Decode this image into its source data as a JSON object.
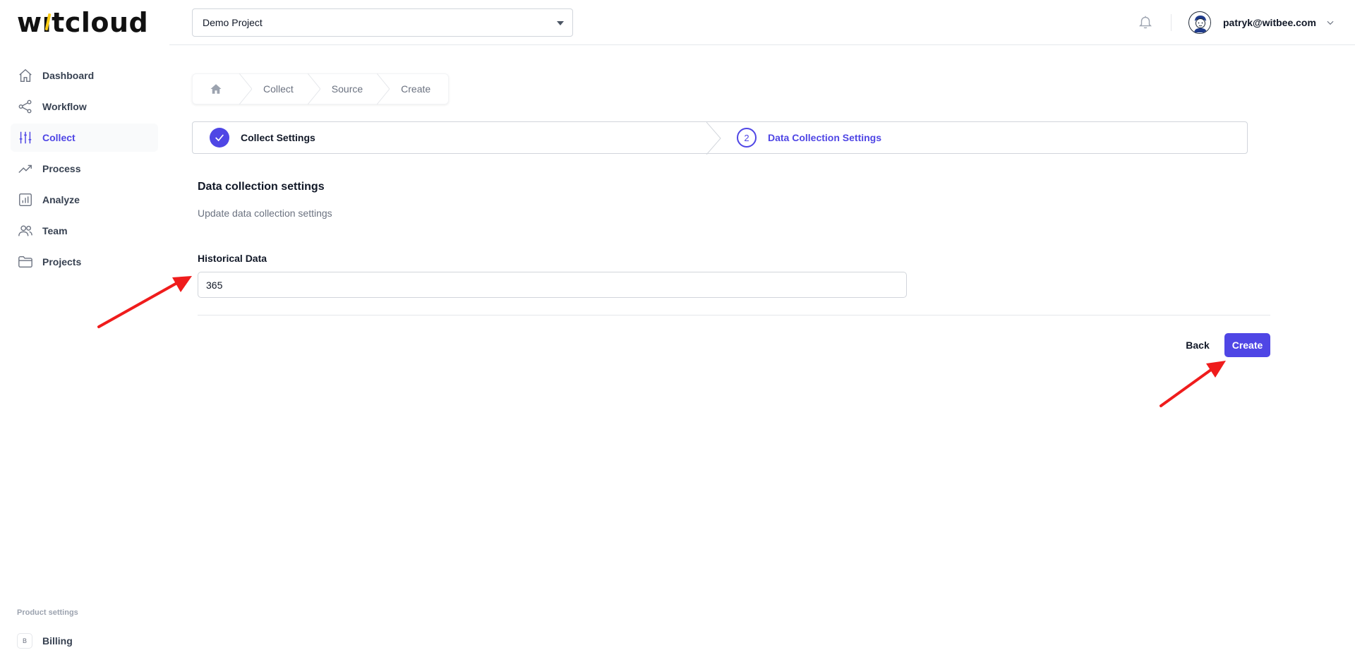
{
  "brand": {
    "logo_text_pre": "w",
    "logo_text_t": "ı",
    "logo_text_post": "tcloud",
    "accent_color": "#4f46e5",
    "logo_accent_color": "#facc15"
  },
  "sidebar": {
    "items": [
      {
        "label": "Dashboard",
        "icon": "home-icon"
      },
      {
        "label": "Workflow",
        "icon": "share-icon"
      },
      {
        "label": "Collect",
        "icon": "sliders-icon",
        "active": true
      },
      {
        "label": "Process",
        "icon": "trending-up-icon"
      },
      {
        "label": "Analyze",
        "icon": "bar-chart-icon"
      },
      {
        "label": "Team",
        "icon": "users-icon"
      },
      {
        "label": "Projects",
        "icon": "folder-icon"
      }
    ],
    "product_settings_label": "Product settings",
    "billing": {
      "badge": "B",
      "label": "Billing"
    }
  },
  "header": {
    "project_select": {
      "value": "Demo Project"
    },
    "user": {
      "email": "patryk@witbee.com"
    }
  },
  "breadcrumb": {
    "items": [
      "Collect",
      "Source",
      "Create"
    ]
  },
  "stepper": {
    "step1": {
      "label": "Collect Settings",
      "status": "complete"
    },
    "step2": {
      "number": "2",
      "label": "Data Collection Settings",
      "status": "current"
    }
  },
  "form": {
    "title": "Data collection settings",
    "description": "Update data collection settings",
    "historical_data": {
      "label": "Historical Data",
      "value": "365"
    },
    "back_label": "Back",
    "create_label": "Create"
  },
  "annotation_color": "#ef1c1c"
}
